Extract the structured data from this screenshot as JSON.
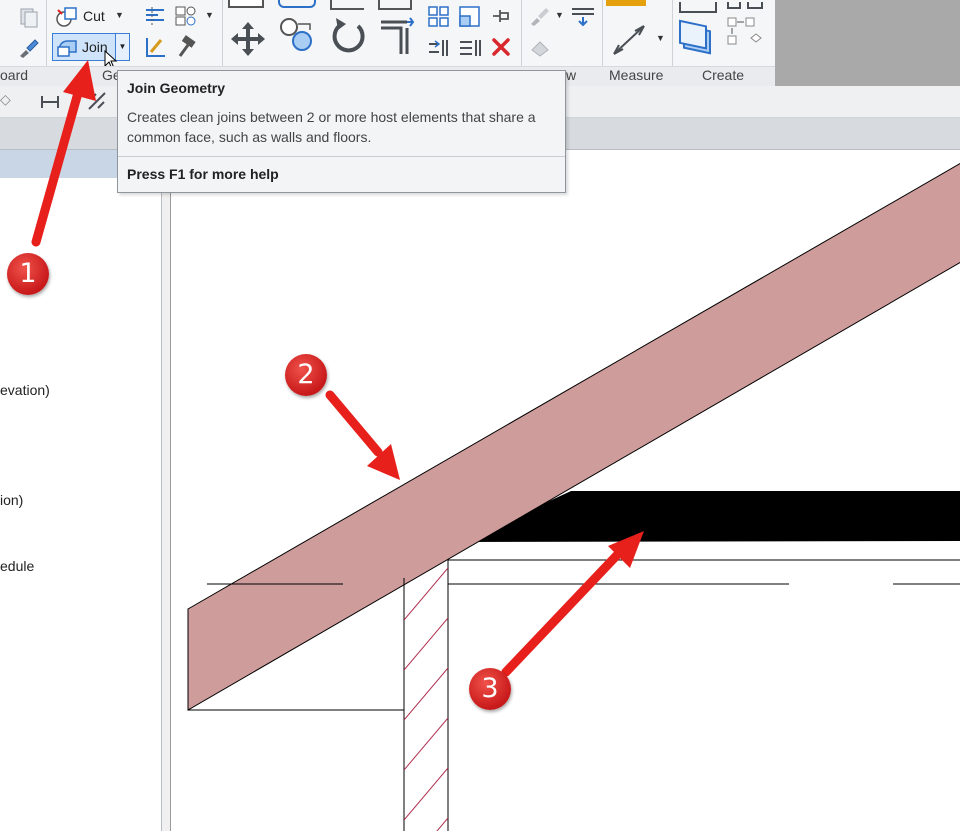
{
  "ribbon": {
    "cut_label": "Cut",
    "join_label": "Join",
    "panels": {
      "clipboard_partial": "oard",
      "geometry_partial": "Ge",
      "view_partial": "w",
      "measure": "Measure",
      "create": "Create"
    }
  },
  "tooltip": {
    "title": "Join Geometry",
    "description": "Creates clean joins between 2 or more host elements that share a common face, such as walls and floors.",
    "help": "Press F1 for more help"
  },
  "project_browser": {
    "items": [
      "evation)",
      "ion)",
      "edule"
    ]
  },
  "callouts": [
    "1",
    "2",
    "3"
  ],
  "colors": {
    "roof": "#cd9c9b",
    "slab": "#000000",
    "arrow": "#e8201c",
    "hatch": "#b03050",
    "ribbon_bg": "#f5f6f7"
  },
  "icons": {
    "join": "join-geometry-icon",
    "cut": "cut-geometry-icon",
    "move": "move-icon",
    "rotate": "rotate-icon",
    "delete": "delete-icon",
    "measure": "measure-icon",
    "create": "create-group-icon"
  }
}
